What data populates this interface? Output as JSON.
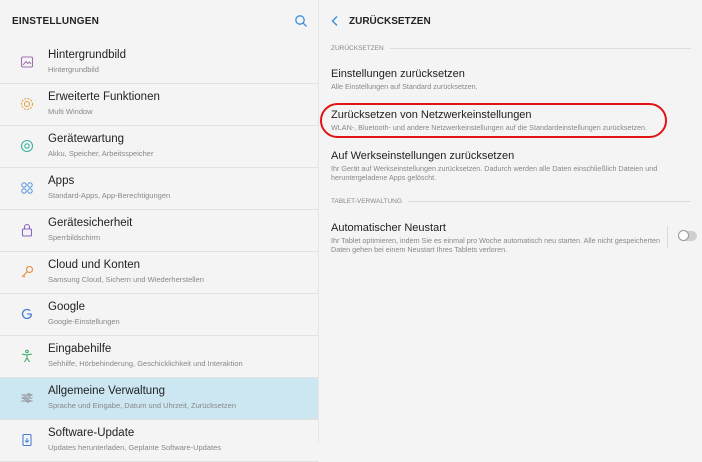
{
  "left": {
    "title": "EINSTELLUNGEN"
  },
  "sidebar": {
    "items": [
      {
        "title": "Hintergrundbild",
        "sub": "Hintergrundbild",
        "icon": "wallpaper-icon",
        "color": "#a36fb0"
      },
      {
        "title": "Erweiterte Funktionen",
        "sub": "Multi Window",
        "icon": "advanced-features-icon",
        "color": "#e6a03c"
      },
      {
        "title": "Gerätewartung",
        "sub": "Akku, Speicher, Arbeitsspeicher",
        "icon": "device-maintenance-icon",
        "color": "#3ab5a4"
      },
      {
        "title": "Apps",
        "sub": "Standard-Apps, App-Berechtigungen",
        "icon": "apps-icon",
        "color": "#4a90d9"
      },
      {
        "title": "Gerätesicherheit",
        "sub": "Sperrbildschirm",
        "icon": "lock-icon",
        "color": "#8a63c7"
      },
      {
        "title": "Cloud und Konten",
        "sub": "Samsung Cloud, Sichern und Wiederherstellen",
        "icon": "key-icon",
        "color": "#e68a3c"
      },
      {
        "title": "Google",
        "sub": "Google-Einstellungen",
        "icon": "google-icon",
        "color": "#4a7fd9"
      },
      {
        "title": "Eingabehilfe",
        "sub": "Sehhilfe, Hörbehinderung, Geschicklichkeit und Interaktion",
        "icon": "accessibility-icon",
        "color": "#3aa865"
      },
      {
        "title": "Allgemeine Verwaltung",
        "sub": "Sprache und Eingabe, Datum und Uhrzeit, Zurücksetzen",
        "icon": "general-management-icon",
        "color": "#8a8a8a",
        "active": true
      },
      {
        "title": "Software-Update",
        "sub": "Updates herunterladen, Geplante Software-Updates",
        "icon": "software-update-icon",
        "color": "#4a7fd9"
      }
    ]
  },
  "right": {
    "title": "ZURÜCKSETZEN",
    "section1": "ZURÜCKSETZEN",
    "items": [
      {
        "title": "Einstellungen zurücksetzen",
        "sub": "Alle Einstellungen auf Standard zurücksetzen."
      },
      {
        "title": "Zurücksetzen von Netzwerkeinstellungen",
        "sub": "WLAN-, Bluetooth- und andere Netzwerkeinstellungen auf die Standardeinstellungen zurücksetzen."
      },
      {
        "title": "Auf Werkseinstellungen zurücksetzen",
        "sub": "Ihr Gerät auf Werkseinstellungen zurücksetzen. Dadurch werden alle Daten einschließlich Dateien und heruntergeladene Apps gelöscht."
      }
    ],
    "section2": "TABLET-VERWALTUNG",
    "auto_restart": {
      "title": "Automatischer Neustart",
      "sub": "Ihr Tablet optimieren, indem Sie es einmal pro Woche automatisch neu starten. Alle nicht gespeicherten Daten gehen bei einem Neustart Ihres Tablets verloren.",
      "enabled": false
    }
  },
  "colors": {
    "accent": "#3a8fd9",
    "highlight": "#e01414",
    "active_bg": "#cce6f2"
  }
}
